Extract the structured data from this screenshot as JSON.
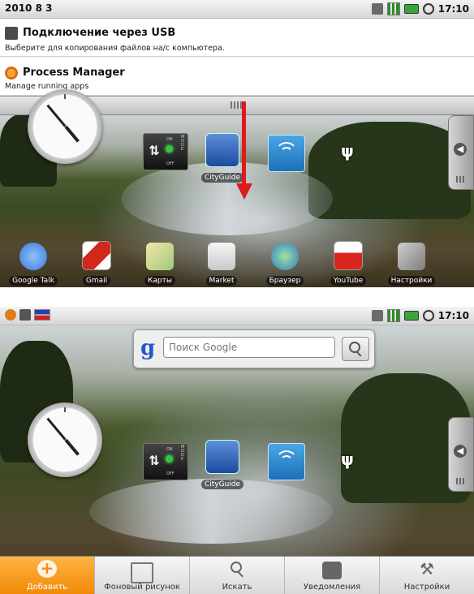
{
  "top": {
    "status_date": "2010 8 3",
    "status_time": "17:10",
    "notifications": [
      {
        "title": "Подключение через USB",
        "text": "Выберите для копирования файлов на/с компьютера."
      },
      {
        "title": "Process Manager",
        "text": "Manage running apps"
      }
    ],
    "widgets": {
      "toggle_on": "ON",
      "toggle_off": "OFF",
      "toggle_mode": "MODE",
      "cityguide": "CityGuide"
    },
    "dock": [
      "Google Talk",
      "Gmail",
      "Карты",
      "Market",
      "Браузер",
      "YouTube",
      "Настройки"
    ]
  },
  "bottom": {
    "status_time": "17:10",
    "search_placeholder": "Поиск Google",
    "search_logo": "g",
    "cityguide": "CityGuide",
    "toggle_on": "ON",
    "toggle_off": "OFF",
    "toggle_mode": "MODE",
    "menu": [
      "Добавить",
      "Фоновый рисунок",
      "Искать",
      "Уведомления",
      "Настройки"
    ]
  },
  "colors": {
    "accent_orange": "#f08a07",
    "arrow_red": "#e01a1a",
    "google_blue": "#2555c7"
  }
}
